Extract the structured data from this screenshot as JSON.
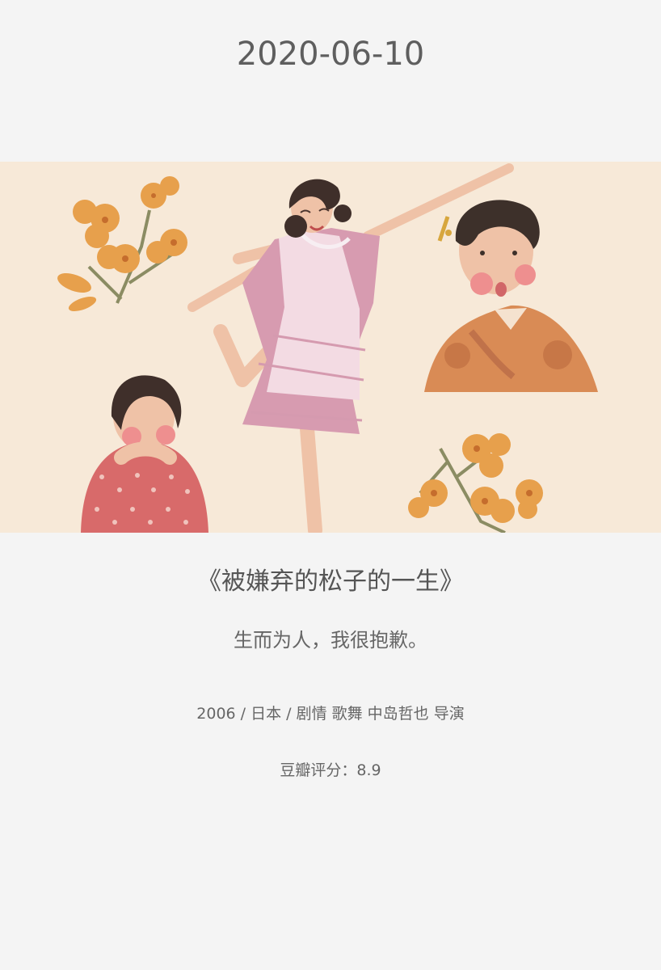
{
  "card": {
    "date": "2020-06-10",
    "title": "《被嫌弃的松子的一生》",
    "quote": "生而为人，我很抱歉。",
    "meta": "2006 / 日本 / 剧情 歌舞 中岛哲也 导演",
    "rating": "豆瓣评分：8.9"
  },
  "colors": {
    "background": "#f4f4f4",
    "text": "#5f5f5f",
    "illustration_bg": "#f7e9d8",
    "flower": "#e7a04c",
    "dress": "#d79bb0",
    "apron": "#f3dbe3",
    "kimono": "#d98b55",
    "polka": "#d86a6a"
  }
}
